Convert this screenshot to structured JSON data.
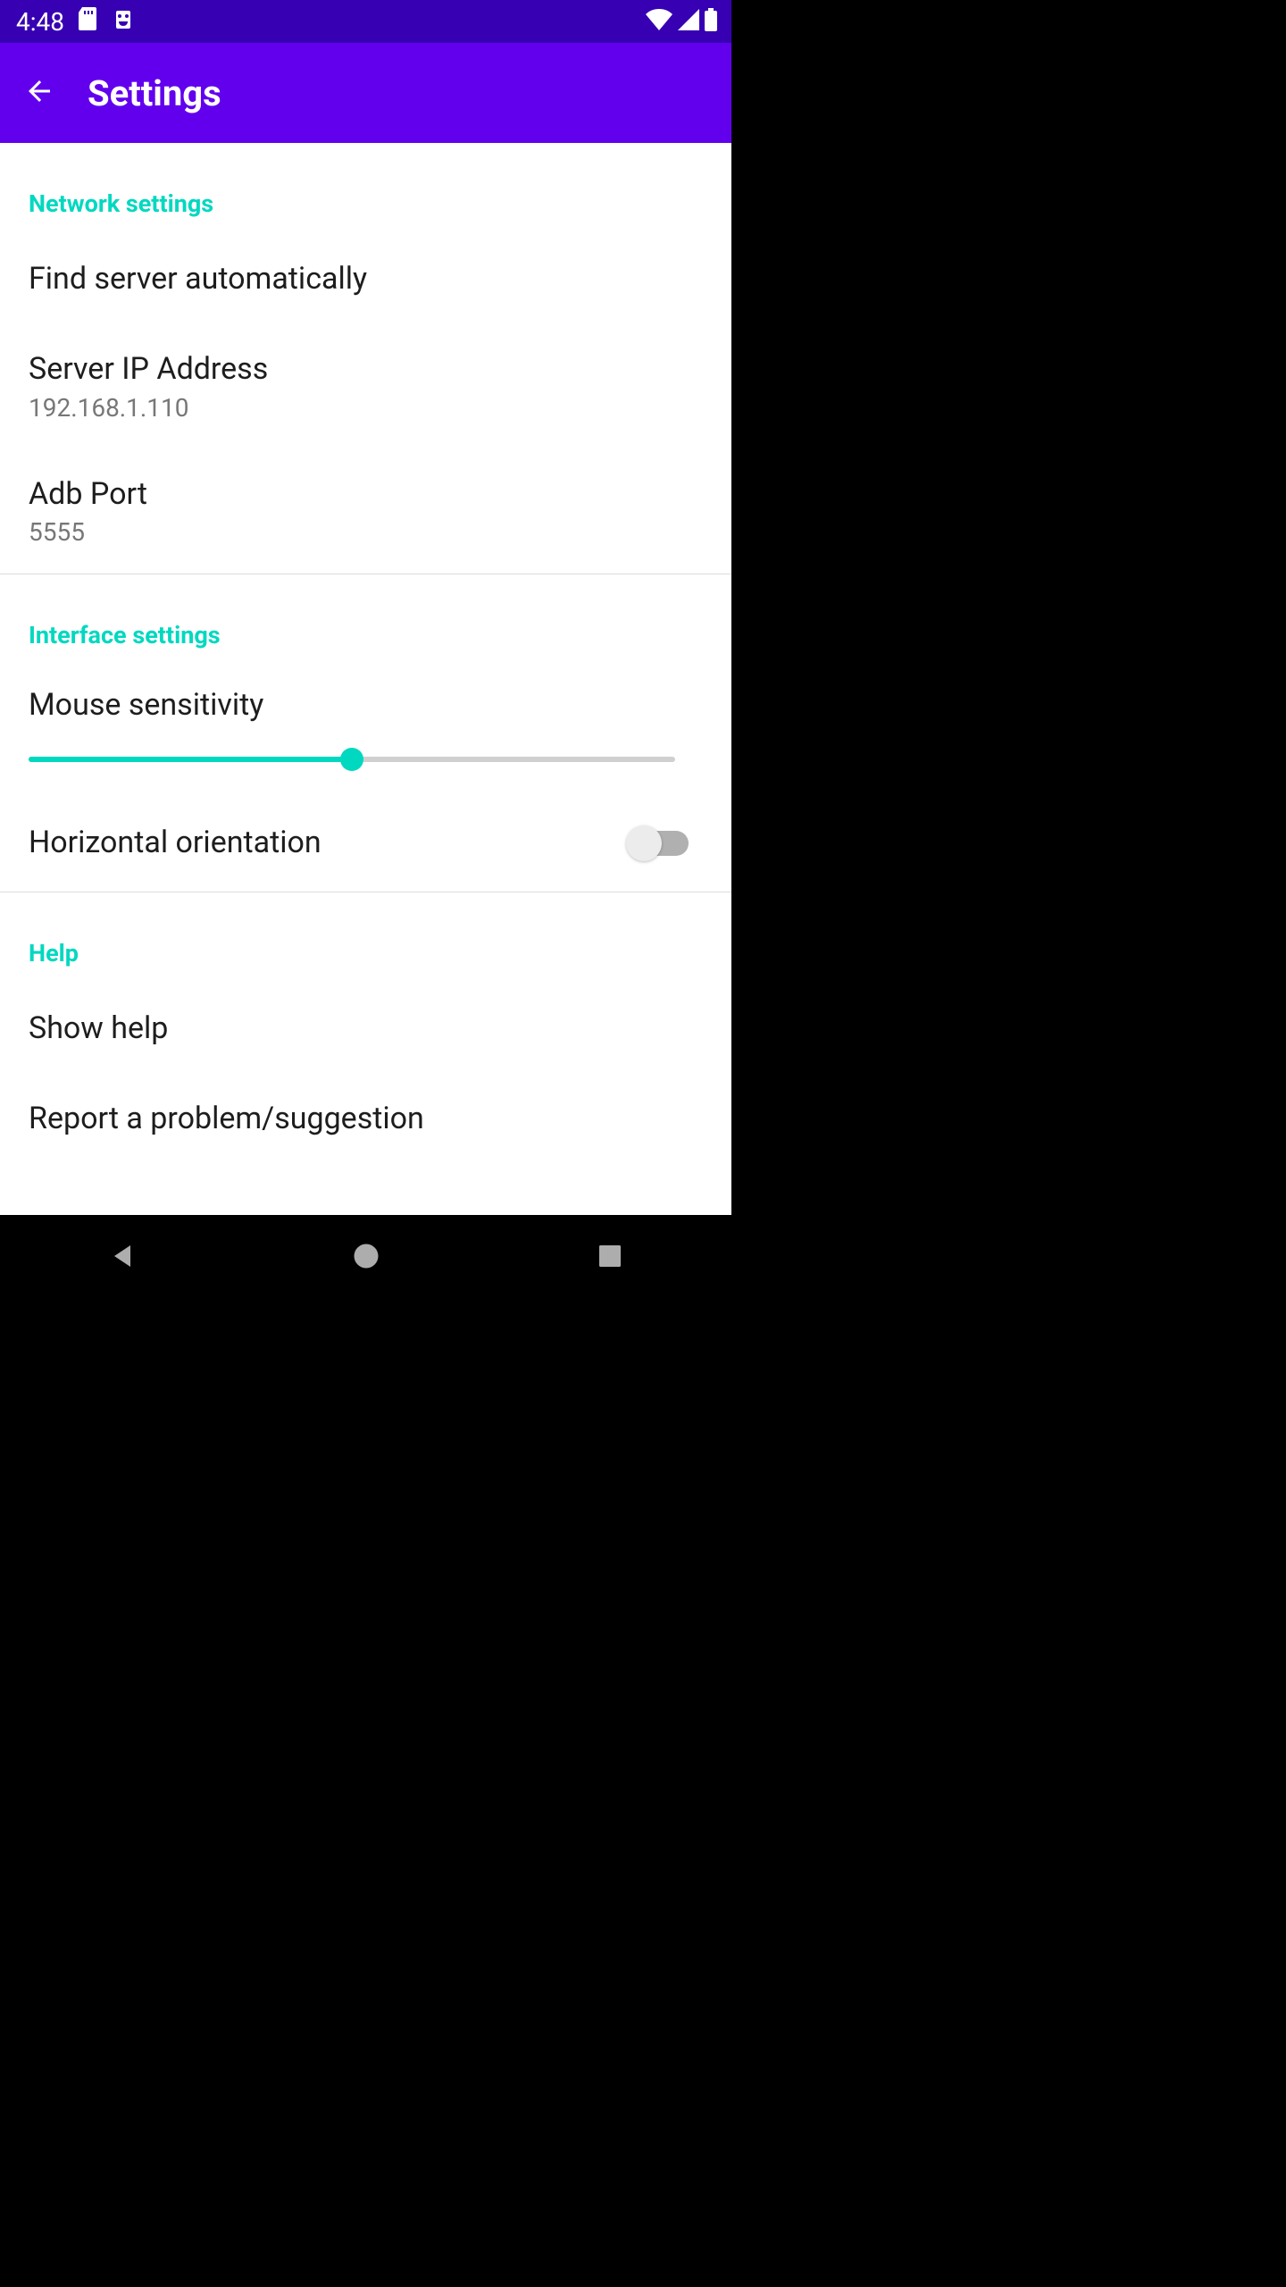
{
  "status": {
    "time": "4:48"
  },
  "appbar": {
    "title": "Settings"
  },
  "sections": {
    "network": {
      "header": "Network settings",
      "find_server": "Find server automatically",
      "server_ip_title": "Server IP Address",
      "server_ip_value": "192.168.1.110",
      "adb_port_title": "Adb Port",
      "adb_port_value": "5555"
    },
    "interface": {
      "header": "Interface settings",
      "mouse_sensitivity_title": "Mouse sensitivity",
      "mouse_sensitivity_percent": 50,
      "horizontal_orientation_title": "Horizontal orientation",
      "horizontal_orientation_on": false
    },
    "help": {
      "header": "Help",
      "show_help": "Show help",
      "report": "Report a problem/suggestion"
    }
  }
}
